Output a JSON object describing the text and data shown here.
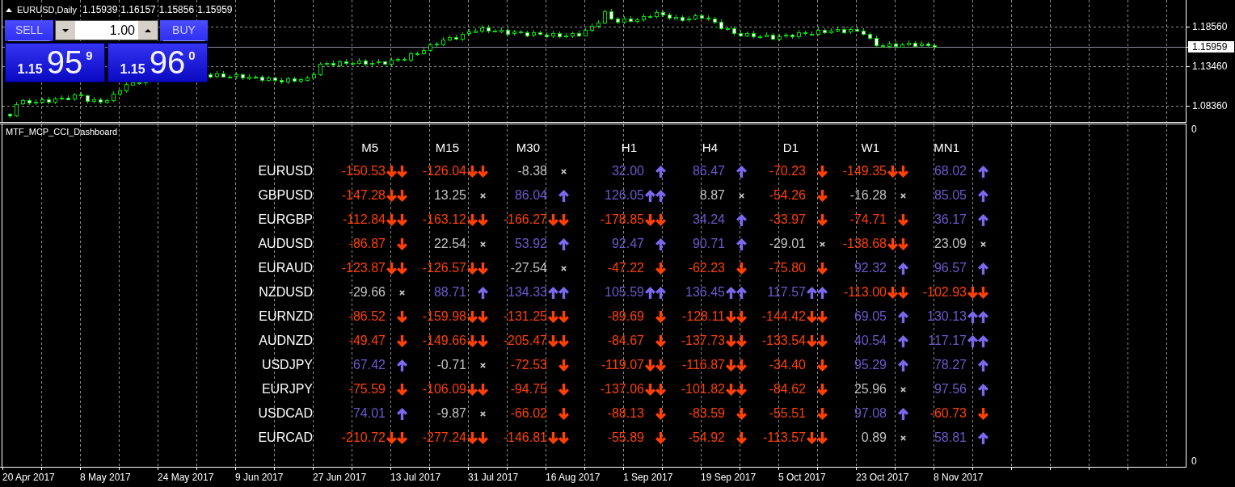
{
  "chart_header": {
    "symbol": "EURUSD,Daily",
    "ohlc": [
      "1.15939",
      "1.16157",
      "1.15856",
      "1.15959"
    ]
  },
  "trade_panel": {
    "sell_button": "SELL",
    "lot_field": {
      "value": "1.00"
    },
    "buy_button": "BUY",
    "sell_price": {
      "prefix": "1.15",
      "big": "95",
      "pip": "9"
    },
    "buy_price": {
      "prefix": "1.15",
      "big": "96",
      "pip": "0"
    }
  },
  "price_axis": [
    {
      "label": "1.18560",
      "current": false
    },
    {
      "label": "1.15959",
      "current": true
    },
    {
      "label": "1.13460",
      "current": false
    },
    {
      "label": "1.08360",
      "current": false
    }
  ],
  "indicator_pane": {
    "title": "MTF_MCP_CCI_Dashboard",
    "axis_labels": [
      "0",
      "0"
    ],
    "columns": [
      "M5",
      "M15",
      "M30",
      "H1",
      "H4",
      "D1",
      "W1",
      "MN1"
    ],
    "rows": [
      {
        "symbol": "EURUSD",
        "cells": [
          {
            "value": "-150.53",
            "kind": "doubledown"
          },
          {
            "value": "-126.04",
            "kind": "doubledown"
          },
          {
            "value": "-8.38",
            "kind": "neutral"
          },
          {
            "value": "32.00",
            "kind": "up"
          },
          {
            "value": "86.47",
            "kind": "up"
          },
          {
            "value": "-70.23",
            "kind": "down"
          },
          {
            "value": "-149.35",
            "kind": "doubledown"
          },
          {
            "value": "68.02",
            "kind": "up"
          }
        ]
      },
      {
        "symbol": "GBPUSD",
        "cells": [
          {
            "value": "-147.28",
            "kind": "doubledown"
          },
          {
            "value": "13.25",
            "kind": "neutral"
          },
          {
            "value": "86.04",
            "kind": "up"
          },
          {
            "value": "126.05",
            "kind": "doubleup"
          },
          {
            "value": "8.87",
            "kind": "neutral"
          },
          {
            "value": "-54.26",
            "kind": "down"
          },
          {
            "value": "-16.28",
            "kind": "neutral"
          },
          {
            "value": "85.05",
            "kind": "up"
          }
        ]
      },
      {
        "symbol": "EURGBP",
        "cells": [
          {
            "value": "-112.84",
            "kind": "doubledown"
          },
          {
            "value": "-163.12",
            "kind": "doubledown"
          },
          {
            "value": "-166.27",
            "kind": "doubledown"
          },
          {
            "value": "-178.85",
            "kind": "doubledown"
          },
          {
            "value": "34.24",
            "kind": "up"
          },
          {
            "value": "-33.97",
            "kind": "down"
          },
          {
            "value": "-74.71",
            "kind": "down"
          },
          {
            "value": "36.17",
            "kind": "up"
          }
        ]
      },
      {
        "symbol": "AUDUSD",
        "cells": [
          {
            "value": "-86.87",
            "kind": "down"
          },
          {
            "value": "22.54",
            "kind": "neutral"
          },
          {
            "value": "53.92",
            "kind": "up"
          },
          {
            "value": "92.47",
            "kind": "up"
          },
          {
            "value": "90.71",
            "kind": "up"
          },
          {
            "value": "-29.01",
            "kind": "neutral"
          },
          {
            "value": "-138.68",
            "kind": "doubledown"
          },
          {
            "value": "23.09",
            "kind": "neutral"
          }
        ]
      },
      {
        "symbol": "EURAUD",
        "cells": [
          {
            "value": "-123.87",
            "kind": "doubledown"
          },
          {
            "value": "-126.57",
            "kind": "doubledown"
          },
          {
            "value": "-27.54",
            "kind": "neutral"
          },
          {
            "value": "-47.22",
            "kind": "down"
          },
          {
            "value": "-62.23",
            "kind": "down"
          },
          {
            "value": "-75.80",
            "kind": "down"
          },
          {
            "value": "92.32",
            "kind": "up"
          },
          {
            "value": "96.57",
            "kind": "up"
          }
        ]
      },
      {
        "symbol": "NZDUSD",
        "cells": [
          {
            "value": "-29.66",
            "kind": "neutral"
          },
          {
            "value": "88.71",
            "kind": "up"
          },
          {
            "value": "134.33",
            "kind": "doubleup"
          },
          {
            "value": "105.59",
            "kind": "doubleup"
          },
          {
            "value": "136.45",
            "kind": "doubleup"
          },
          {
            "value": "117.57",
            "kind": "doubleup"
          },
          {
            "value": "-113.00",
            "kind": "doubledown"
          },
          {
            "value": "-102.93",
            "kind": "doubledown"
          }
        ]
      },
      {
        "symbol": "EURNZD",
        "cells": [
          {
            "value": "-86.52",
            "kind": "down"
          },
          {
            "value": "-159.98",
            "kind": "doubledown"
          },
          {
            "value": "-131.25",
            "kind": "doubledown"
          },
          {
            "value": "-89.69",
            "kind": "down"
          },
          {
            "value": "-128.11",
            "kind": "doubledown"
          },
          {
            "value": "-144.42",
            "kind": "doubledown"
          },
          {
            "value": "69.05",
            "kind": "up"
          },
          {
            "value": "130.13",
            "kind": "doubleup"
          }
        ]
      },
      {
        "symbol": "AUDNZD",
        "cells": [
          {
            "value": "-49.47",
            "kind": "down"
          },
          {
            "value": "-149.66",
            "kind": "doubledown"
          },
          {
            "value": "-205.47",
            "kind": "doubledown"
          },
          {
            "value": "-84.67",
            "kind": "down"
          },
          {
            "value": "-137.73",
            "kind": "doubledown"
          },
          {
            "value": "-133.54",
            "kind": "doubledown"
          },
          {
            "value": "40.54",
            "kind": "up"
          },
          {
            "value": "117.17",
            "kind": "doubleup"
          }
        ]
      },
      {
        "symbol": "USDJPY",
        "cells": [
          {
            "value": "67.42",
            "kind": "up"
          },
          {
            "value": "-0.71",
            "kind": "neutral"
          },
          {
            "value": "-72.53",
            "kind": "down"
          },
          {
            "value": "-119.07",
            "kind": "doubledown"
          },
          {
            "value": "-116.87",
            "kind": "doubledown"
          },
          {
            "value": "-34.40",
            "kind": "down"
          },
          {
            "value": "95.29",
            "kind": "up"
          },
          {
            "value": "78.27",
            "kind": "up"
          }
        ]
      },
      {
        "symbol": "EURJPY",
        "cells": [
          {
            "value": "-75.59",
            "kind": "down"
          },
          {
            "value": "-106.09",
            "kind": "doubledown"
          },
          {
            "value": "-94.75",
            "kind": "down"
          },
          {
            "value": "-137.06",
            "kind": "doubledown"
          },
          {
            "value": "-101.82",
            "kind": "doubledown"
          },
          {
            "value": "-84.62",
            "kind": "down"
          },
          {
            "value": "25.96",
            "kind": "neutral"
          },
          {
            "value": "97.56",
            "kind": "up"
          }
        ]
      },
      {
        "symbol": "USDCAD",
        "cells": [
          {
            "value": "74.01",
            "kind": "up"
          },
          {
            "value": "-9.87",
            "kind": "neutral"
          },
          {
            "value": "-66.02",
            "kind": "down"
          },
          {
            "value": "-88.13",
            "kind": "down"
          },
          {
            "value": "-83.59",
            "kind": "down"
          },
          {
            "value": "-55.51",
            "kind": "down"
          },
          {
            "value": "97.08",
            "kind": "up"
          },
          {
            "value": "-60.73",
            "kind": "down"
          }
        ]
      },
      {
        "symbol": "EURCAD",
        "cells": [
          {
            "value": "-210.72",
            "kind": "doubledown"
          },
          {
            "value": "-277.24",
            "kind": "doubledown"
          },
          {
            "value": "-146.81",
            "kind": "doubledown"
          },
          {
            "value": "-55.89",
            "kind": "down"
          },
          {
            "value": "-54.92",
            "kind": "down"
          },
          {
            "value": "-113.57",
            "kind": "doubledown"
          },
          {
            "value": "0.89",
            "kind": "neutral"
          },
          {
            "value": "58.81",
            "kind": "up"
          }
        ]
      }
    ]
  },
  "time_axis": [
    "20 Apr 2017",
    "8 May 2017",
    "24 May 2017",
    "9 Jun 2017",
    "27 Jun 2017",
    "13 Jul 2017",
    "31 Jul 2017",
    "16 Aug 2017",
    "1 Sep 2017",
    "19 Sep 2017",
    "5 Oct 2017",
    "23 Oct 2017",
    "8 Nov 2017"
  ]
}
